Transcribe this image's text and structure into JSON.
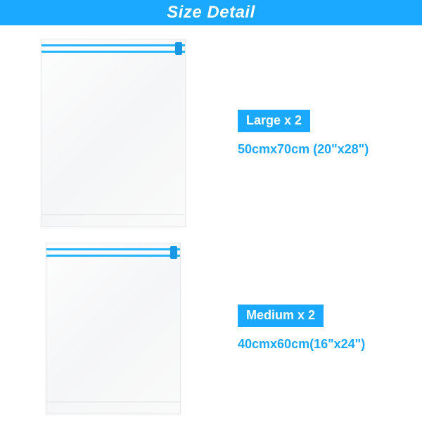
{
  "banner": {
    "title": "Size Detail"
  },
  "items": [
    {
      "badge": "Large x 2",
      "dimensions": "50cmx70cm (20\"x28\")"
    },
    {
      "badge": "Medium x 2",
      "dimensions": "40cmx60cm(16\"x24\")"
    }
  ]
}
